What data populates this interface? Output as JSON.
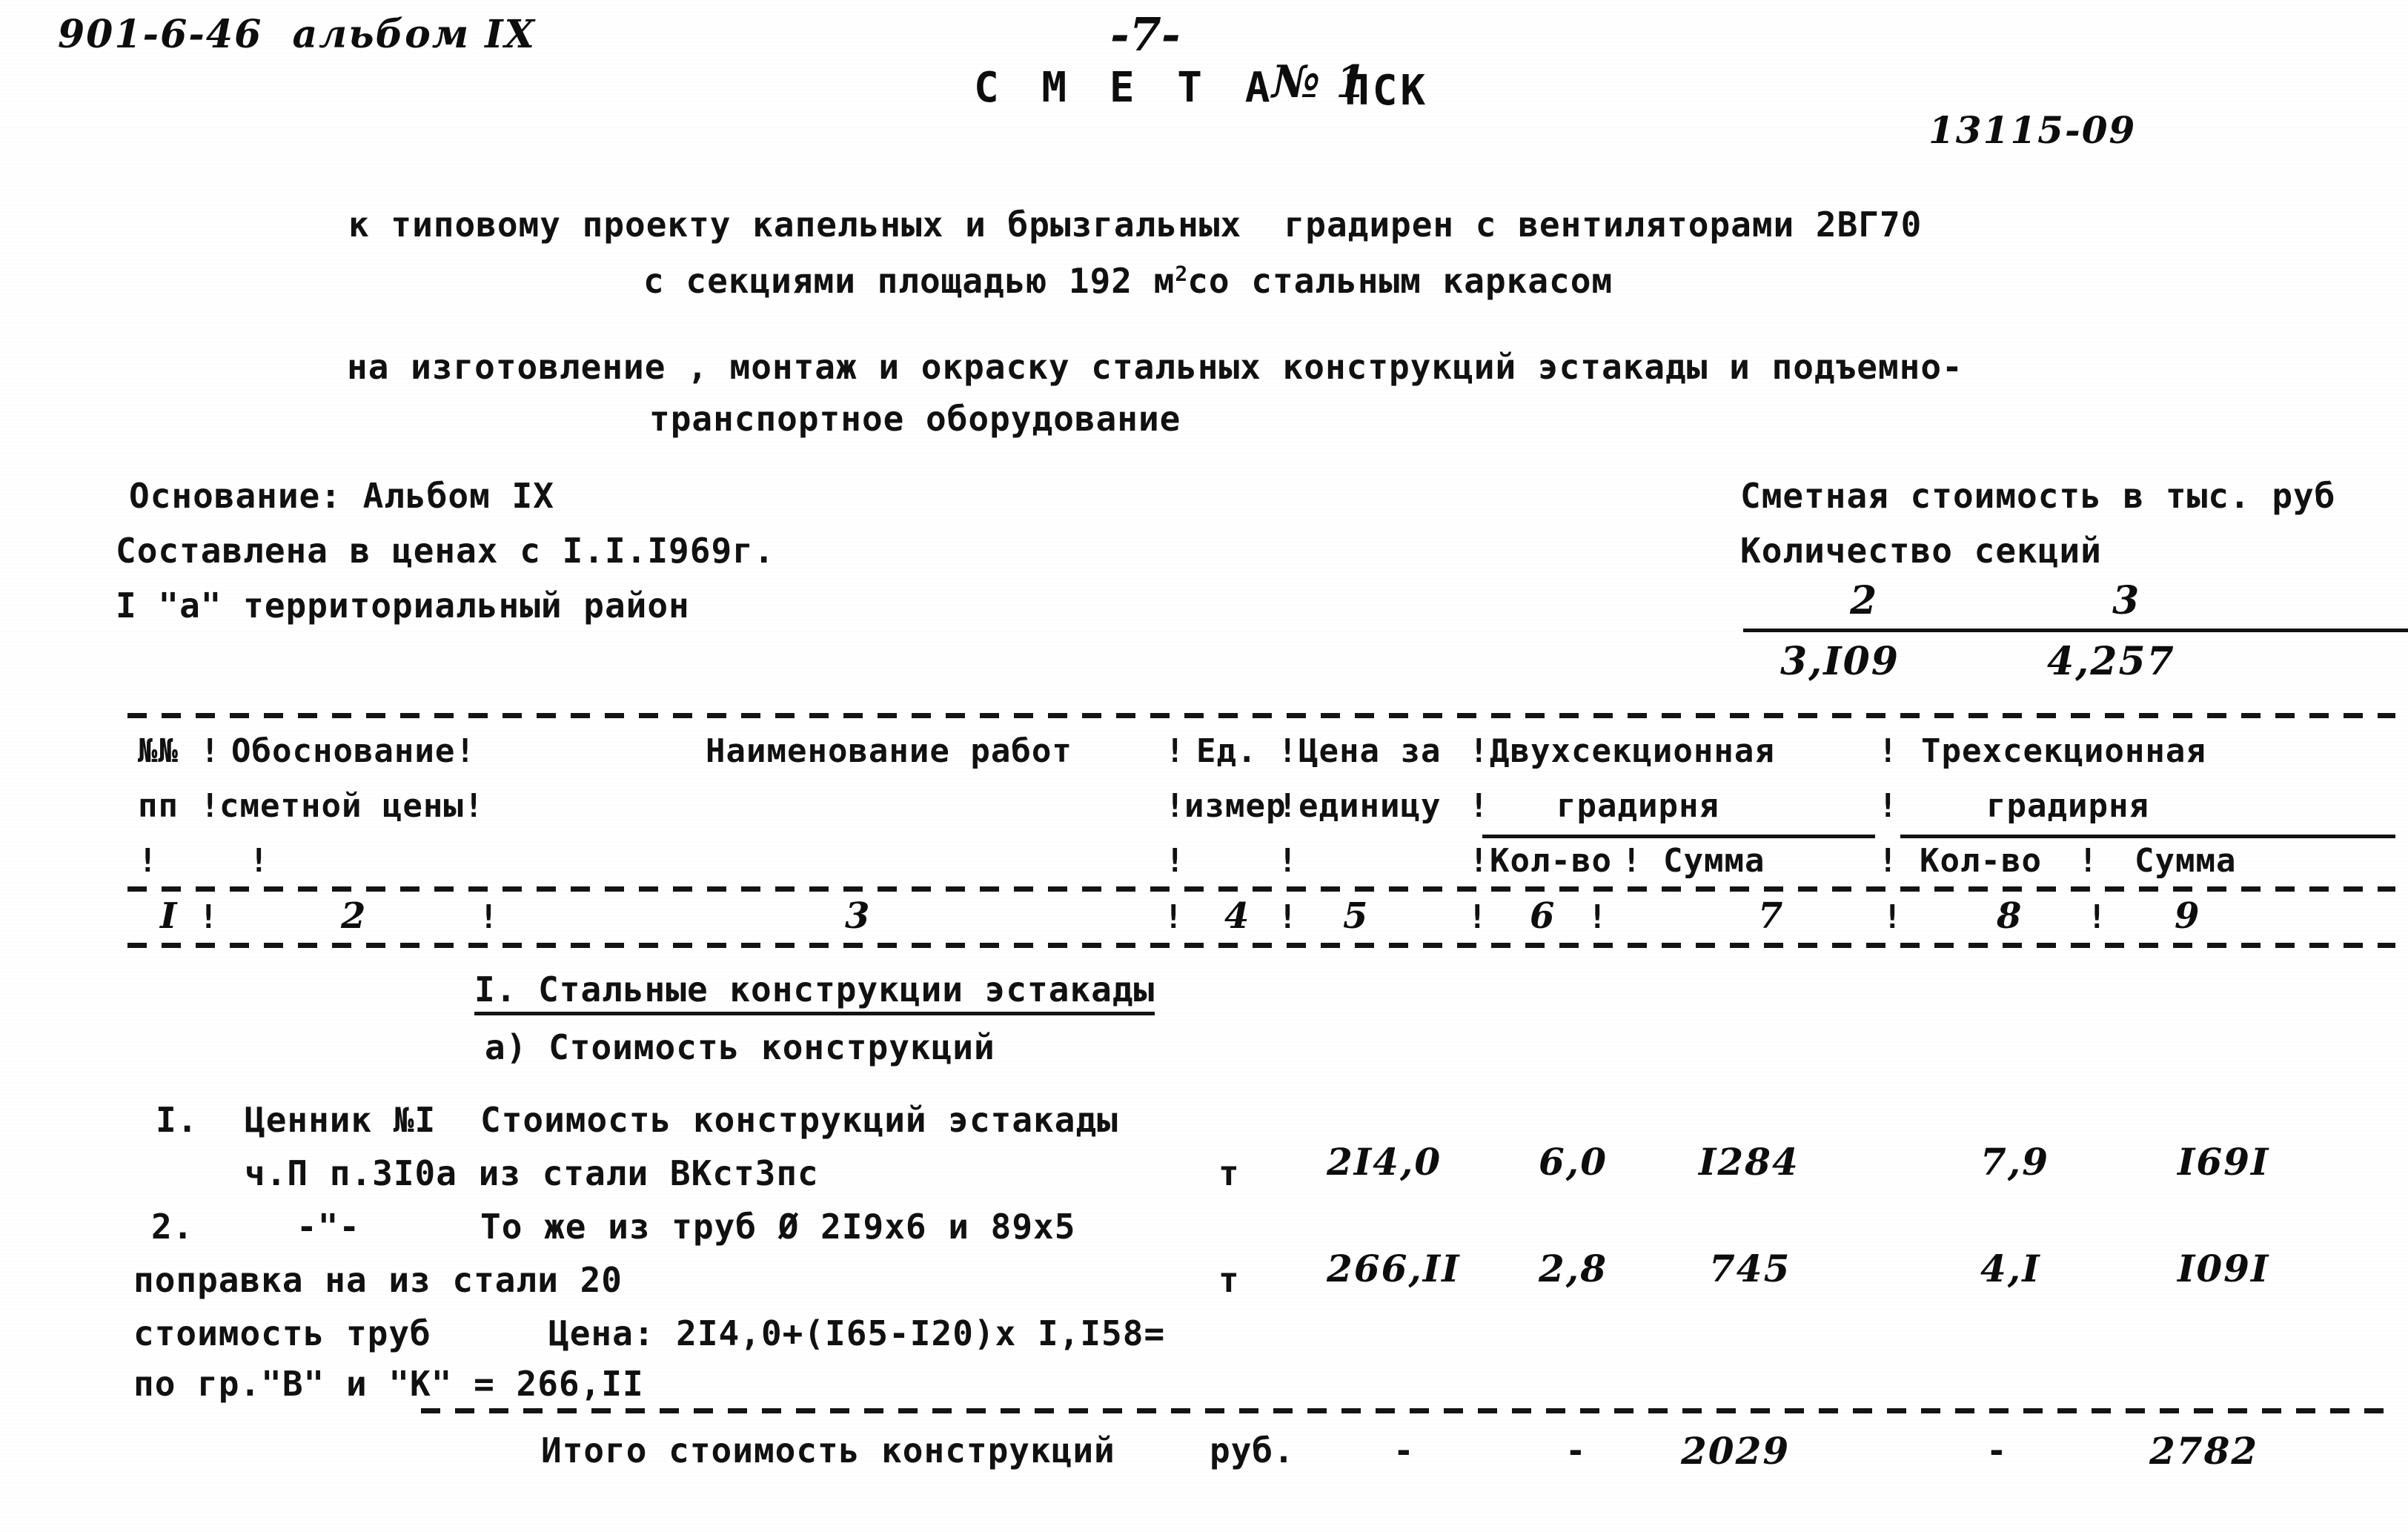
{
  "document": {
    "margin_note": "901-6-46  альбом IX",
    "page_number": "-7-",
    "title_prefix": "С М Е Т А",
    "title_number": "№ 1",
    "title_suffix": "ПСК",
    "doc_code": "13115-09",
    "heading_lines": [
      "к типовому проекту капельных и брызгальных  градирен с вентиляторами 2ВГ70",
      "с секциями площадью 192 м",
      "со стальным каркасом",
      "на изготовление , монтаж и окраску стальных конструкций эстакады и подъемно-",
      "транспортное оборудование"
    ],
    "area_exponent": "2"
  },
  "basis_block": {
    "line1": "Основание: Альбом IX",
    "line2": "Составлена в ценах с I.I.I969г.",
    "line3": "I \"а\" территориальный район"
  },
  "cost_summary": {
    "label1": "Сметная стоимость в тыс. руб",
    "label2": "Количество секций",
    "col_headers": [
      "2",
      "3"
    ],
    "values": [
      "3,I09",
      "4,257"
    ]
  },
  "table": {
    "header": {
      "col1_line1": "№№",
      "col1_line2": "пп",
      "col2_line1": "Обоснование!",
      "col2_line2": "сметной цены!",
      "col3_line1": "Наименование работ",
      "col4_line1": "Ед.",
      "col4_line2": "измер",
      "col5_line1": "Цена за",
      "col5_line2": "единицу",
      "group2_line1": "Двухсекционная",
      "group2_line2": "градирня",
      "group3_line1": "Трехсекционная",
      "group3_line2": "градирня",
      "sub_qty2": "Кол-во",
      "sub_sum2": "Сумма",
      "sub_qty3": "Кол-во",
      "sub_sum3": "Сумма",
      "pipe": "!"
    },
    "column_numbers": [
      "I",
      "2",
      "3",
      "4",
      "5",
      "6",
      "7",
      "8",
      "9"
    ],
    "sections": [
      {
        "heading": "I. Стальные конструкции эстакады",
        "subheading": "а) Стоимость конструкций"
      }
    ],
    "rows": [
      {
        "num": "I.",
        "basis": "Ценник №I",
        "desc_line1": "Стоимость конструкций эстакады",
        "desc_line2": "ч.П п.3I0а из стали ВКст3пс",
        "unit": "т",
        "price": "2I4,0",
        "qty2": "6,0",
        "sum2": "I284",
        "qty3": "7,9",
        "sum3": "I69I"
      },
      {
        "num": "2.",
        "basis": "-\"-",
        "desc_line1": "То же из труб Ø 2I9x6 и 89x5",
        "desc_line2": "поправка на из стали 20",
        "desc_line3a": "стоимость труб",
        "desc_line3b": "Цена: 2I4,0+(I65-I20)x I,I58=",
        "desc_line4": "по гр.\"В\" и \"К\" = 266,II",
        "unit": "т",
        "price": "266,II",
        "qty2": "2,8",
        "sum2": "745",
        "qty3": "4,I",
        "sum3": "I09I"
      }
    ],
    "total_row": {
      "label": "Итого стоимость конструкций",
      "unit": "руб.",
      "price": "-",
      "qty2": "-",
      "sum2": "2029",
      "qty3": "-",
      "sum3": "2782"
    }
  }
}
